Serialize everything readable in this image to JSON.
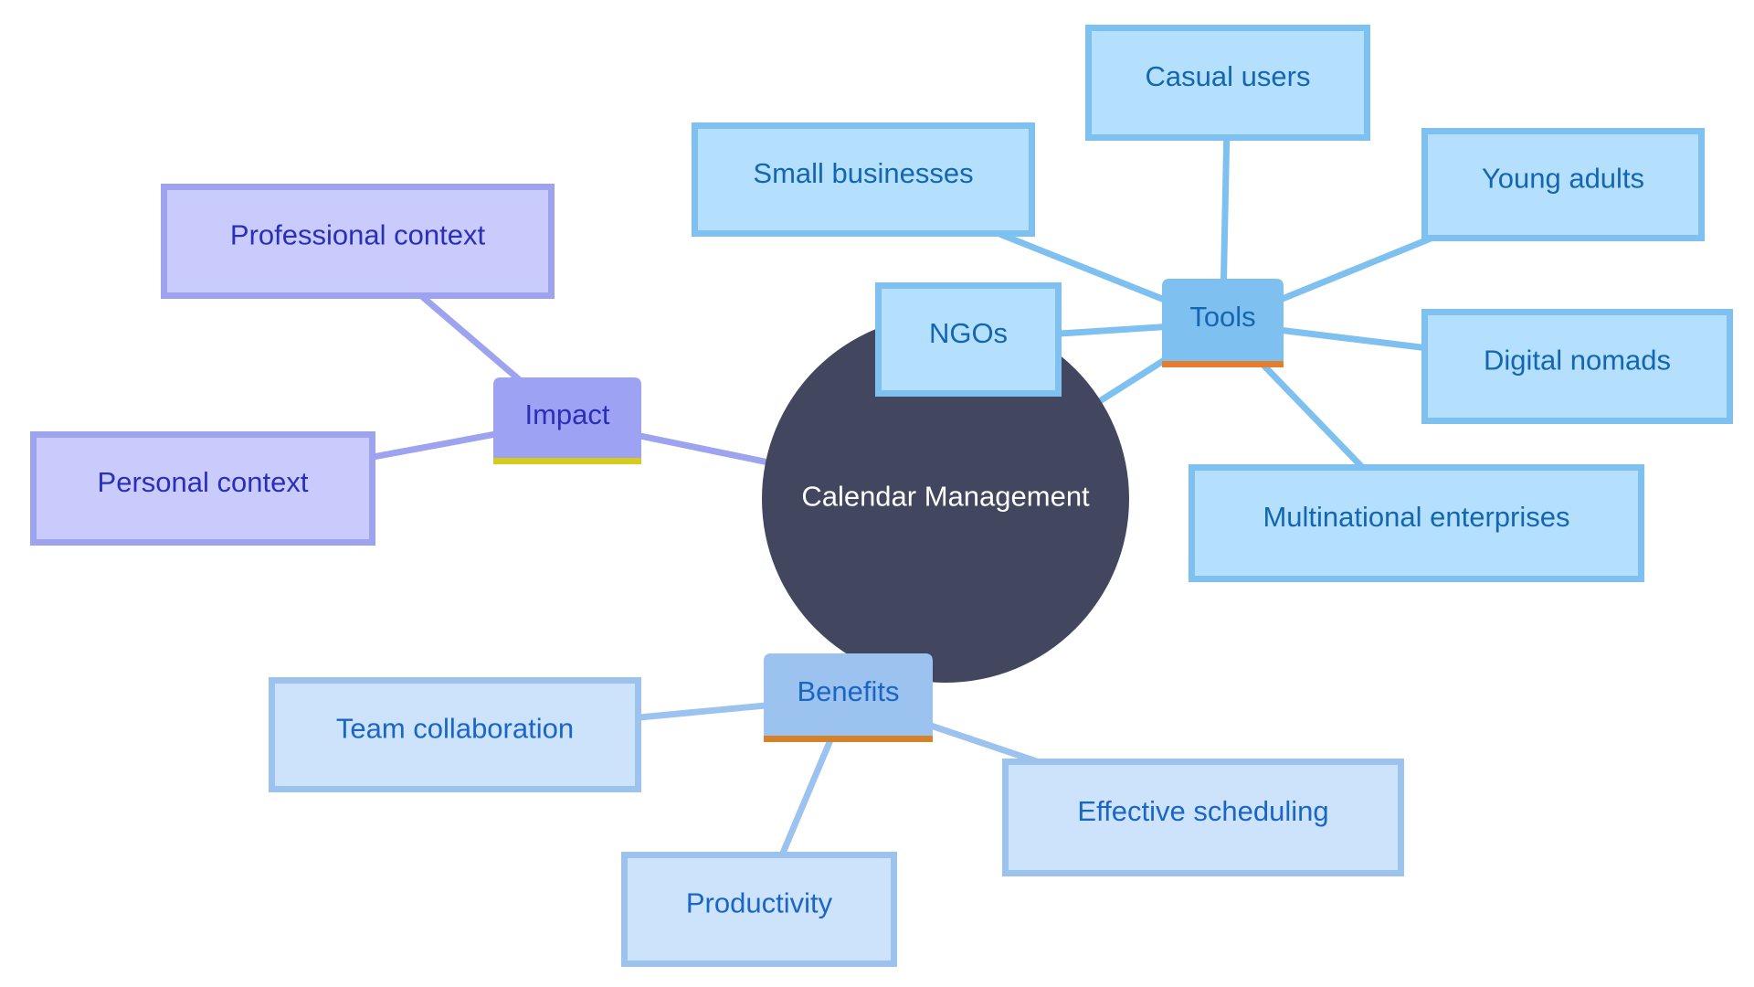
{
  "diagram": {
    "type": "mindmap",
    "root": {
      "label": "Calendar Management",
      "color": "#42465e",
      "text_color": "#ffffff"
    },
    "branches": [
      {
        "id": "impact",
        "label": "Impact",
        "fill": "#9da3f2",
        "text_color": "#2b2fb8",
        "underline": "#d6cc1f",
        "edge": "#9da3ee",
        "child_fill": "#c9cbfd",
        "child_stroke": "#9da3ee",
        "children": [
          {
            "id": "professional-context",
            "label": "Professional context"
          },
          {
            "id": "personal-context",
            "label": "Personal context"
          }
        ]
      },
      {
        "id": "tools",
        "label": "Tools",
        "fill": "#7ec0f0",
        "text_color": "#1466b0",
        "underline": "#e57d2f",
        "edge": "#7ec0f0",
        "child_fill": "#b4e0fd",
        "child_stroke": "#7ec0f0",
        "children": [
          {
            "id": "small-businesses",
            "label": "Small businesses"
          },
          {
            "id": "casual-users",
            "label": "Casual users"
          },
          {
            "id": "young-adults",
            "label": "Young adults"
          },
          {
            "id": "ngos",
            "label": "NGOs"
          },
          {
            "id": "digital-nomads",
            "label": "Digital nomads"
          },
          {
            "id": "multinational-enterprises",
            "label": "Multinational enterprises"
          }
        ]
      },
      {
        "id": "benefits",
        "label": "Benefits",
        "fill": "#9cc3f0",
        "text_color": "#1a66c4",
        "underline": "#d6822a",
        "edge": "#9cc3f0",
        "child_fill": "#cde3fb",
        "child_stroke": "#9cc3ee",
        "children": [
          {
            "id": "team-collaboration",
            "label": "Team collaboration"
          },
          {
            "id": "productivity",
            "label": "Productivity"
          },
          {
            "id": "effective-scheduling",
            "label": "Effective scheduling"
          }
        ]
      }
    ]
  }
}
